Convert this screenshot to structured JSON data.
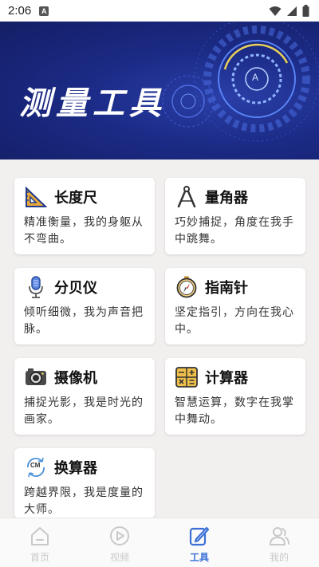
{
  "status_bar": {
    "time": "2:06",
    "notif_letter": "A"
  },
  "banner": {
    "title": "测量工具",
    "gear_letter": "A"
  },
  "tools": [
    {
      "id": "ruler",
      "icon": "ruler-triangle-icon",
      "title": "长度尺",
      "desc": "精准衡量，我的身躯从不弯曲。"
    },
    {
      "id": "protractor",
      "icon": "compass-divider-icon",
      "title": "量角器",
      "desc": "巧妙捕捉，角度在我手中跳舞。"
    },
    {
      "id": "decibel",
      "icon": "microphone-icon",
      "title": "分贝仪",
      "desc": "倾听细微，我为声音把脉。"
    },
    {
      "id": "compass",
      "icon": "compass-icon",
      "title": "指南针",
      "desc": "坚定指引，方向在我心中。"
    },
    {
      "id": "camera",
      "icon": "camera-icon",
      "title": "摄像机",
      "desc": "捕捉光影，我是时光的画家。"
    },
    {
      "id": "calculator",
      "icon": "calculator-icon",
      "title": "计算器",
      "desc": "智慧运算，数字在我掌中舞动。"
    },
    {
      "id": "converter",
      "icon": "unit-converter-icon",
      "title": "换算器",
      "desc": "跨越界限，我是度量的大师。",
      "icon_text": "CM"
    }
  ],
  "tabbar": {
    "items": [
      {
        "label": "首页",
        "icon": "home-icon",
        "active": false
      },
      {
        "label": "视频",
        "icon": "play-icon",
        "active": false
      },
      {
        "label": "工具",
        "icon": "edit-icon",
        "active": true
      },
      {
        "label": "我的",
        "icon": "user-icon",
        "active": false
      }
    ]
  },
  "colors": {
    "accent": "#3b6fd6",
    "banner_bg": "#1b2a85",
    "inactive": "#c9c9c9"
  }
}
